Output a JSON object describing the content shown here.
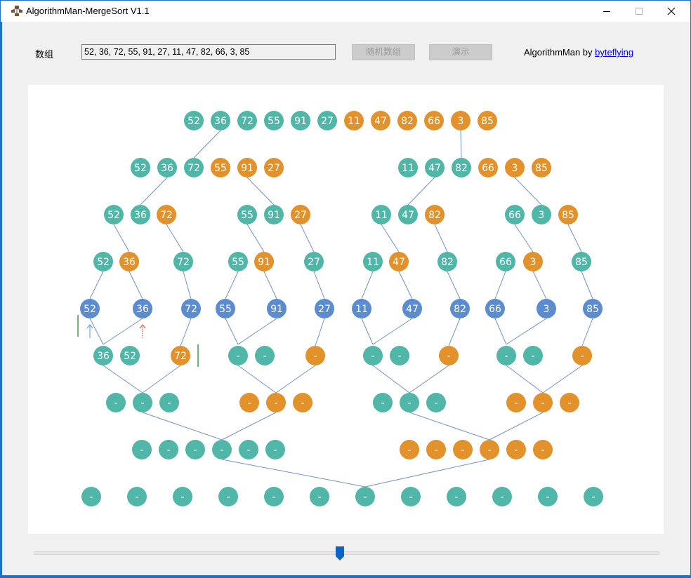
{
  "window": {
    "title": "AlgorithmMan-MergeSort V1.1"
  },
  "toolbar": {
    "array_label": "数组",
    "array_value": "52, 36, 72, 55, 91, 27, 11, 47, 82, 66, 3, 85",
    "random_button": "随机数组",
    "demo_button": "演示",
    "credit_prefix": "AlgorithmMan by ",
    "credit_link": "byteflying"
  },
  "slider": {
    "position_percent": 49
  },
  "colors": {
    "teal": "#4fb6a8",
    "orange": "#e3912a",
    "blue": "#5b8ccf",
    "line": "#6f93c7",
    "left_pointer": "#6fa6e0",
    "right_pointer": "#d0614d",
    "marker_green": "#3a9a4a"
  },
  "tree": {
    "rows": [
      [
        {
          "v": "52",
          "c": "teal"
        },
        {
          "v": "36",
          "c": "teal"
        },
        {
          "v": "72",
          "c": "teal"
        },
        {
          "v": "55",
          "c": "teal"
        },
        {
          "v": "91",
          "c": "teal"
        },
        {
          "v": "27",
          "c": "teal"
        },
        {
          "v": "11",
          "c": "orange"
        },
        {
          "v": "47",
          "c": "orange"
        },
        {
          "v": "82",
          "c": "orange"
        },
        {
          "v": "66",
          "c": "orange"
        },
        {
          "v": "3",
          "c": "orange"
        },
        {
          "v": "85",
          "c": "orange"
        }
      ],
      [
        {
          "v": "52",
          "c": "teal"
        },
        {
          "v": "36",
          "c": "teal"
        },
        {
          "v": "72",
          "c": "teal"
        },
        {
          "v": "55",
          "c": "orange"
        },
        {
          "v": "91",
          "c": "orange"
        },
        {
          "v": "27",
          "c": "orange"
        },
        {
          "v": "11",
          "c": "teal"
        },
        {
          "v": "47",
          "c": "teal"
        },
        {
          "v": "82",
          "c": "teal"
        },
        {
          "v": "66",
          "c": "orange"
        },
        {
          "v": "3",
          "c": "orange"
        },
        {
          "v": "85",
          "c": "orange"
        }
      ],
      [
        {
          "v": "52",
          "c": "teal"
        },
        {
          "v": "36",
          "c": "teal"
        },
        {
          "v": "72",
          "c": "orange"
        },
        {
          "v": "55",
          "c": "teal"
        },
        {
          "v": "91",
          "c": "teal"
        },
        {
          "v": "27",
          "c": "orange"
        },
        {
          "v": "11",
          "c": "teal"
        },
        {
          "v": "47",
          "c": "teal"
        },
        {
          "v": "82",
          "c": "orange"
        },
        {
          "v": "66",
          "c": "teal"
        },
        {
          "v": "3",
          "c": "teal"
        },
        {
          "v": "85",
          "c": "orange"
        }
      ],
      [
        {
          "v": "52",
          "c": "teal"
        },
        {
          "v": "36",
          "c": "orange"
        },
        {
          "v": "72",
          "c": "teal"
        },
        {
          "v": "55",
          "c": "teal"
        },
        {
          "v": "91",
          "c": "orange"
        },
        {
          "v": "27",
          "c": "teal"
        },
        {
          "v": "11",
          "c": "teal"
        },
        {
          "v": "47",
          "c": "orange"
        },
        {
          "v": "82",
          "c": "teal"
        },
        {
          "v": "66",
          "c": "teal"
        },
        {
          "v": "3",
          "c": "orange"
        },
        {
          "v": "85",
          "c": "teal"
        }
      ],
      [
        {
          "v": "52",
          "c": "blue"
        },
        {
          "v": "36",
          "c": "blue"
        },
        {
          "v": "72",
          "c": "blue"
        },
        {
          "v": "55",
          "c": "blue"
        },
        {
          "v": "91",
          "c": "blue"
        },
        {
          "v": "27",
          "c": "blue"
        },
        {
          "v": "11",
          "c": "blue"
        },
        {
          "v": "47",
          "c": "blue"
        },
        {
          "v": "82",
          "c": "blue"
        },
        {
          "v": "66",
          "c": "blue"
        },
        {
          "v": "3",
          "c": "blue"
        },
        {
          "v": "85",
          "c": "blue"
        }
      ],
      [
        {
          "v": "36",
          "c": "teal"
        },
        {
          "v": "52",
          "c": "teal"
        },
        {
          "v": "72",
          "c": "orange"
        },
        {
          "v": "-",
          "c": "teal"
        },
        {
          "v": "-",
          "c": "teal"
        },
        {
          "v": "-",
          "c": "orange"
        },
        {
          "v": "-",
          "c": "teal"
        },
        {
          "v": "-",
          "c": "teal"
        },
        {
          "v": "-",
          "c": "orange"
        },
        {
          "v": "-",
          "c": "teal"
        },
        {
          "v": "-",
          "c": "teal"
        },
        {
          "v": "-",
          "c": "orange"
        }
      ],
      [
        {
          "v": "-",
          "c": "teal"
        },
        {
          "v": "-",
          "c": "teal"
        },
        {
          "v": "-",
          "c": "teal"
        },
        {
          "v": "-",
          "c": "orange"
        },
        {
          "v": "-",
          "c": "orange"
        },
        {
          "v": "-",
          "c": "orange"
        },
        {
          "v": "-",
          "c": "teal"
        },
        {
          "v": "-",
          "c": "teal"
        },
        {
          "v": "-",
          "c": "teal"
        },
        {
          "v": "-",
          "c": "orange"
        },
        {
          "v": "-",
          "c": "orange"
        },
        {
          "v": "-",
          "c": "orange"
        }
      ],
      [
        {
          "v": "-",
          "c": "teal"
        },
        {
          "v": "-",
          "c": "teal"
        },
        {
          "v": "-",
          "c": "teal"
        },
        {
          "v": "-",
          "c": "teal"
        },
        {
          "v": "-",
          "c": "teal"
        },
        {
          "v": "-",
          "c": "teal"
        },
        {
          "v": "-",
          "c": "orange"
        },
        {
          "v": "-",
          "c": "orange"
        },
        {
          "v": "-",
          "c": "orange"
        },
        {
          "v": "-",
          "c": "orange"
        },
        {
          "v": "-",
          "c": "orange"
        },
        {
          "v": "-",
          "c": "orange"
        }
      ],
      [
        {
          "v": "-",
          "c": "teal"
        },
        {
          "v": "-",
          "c": "teal"
        },
        {
          "v": "-",
          "c": "teal"
        },
        {
          "v": "-",
          "c": "teal"
        },
        {
          "v": "-",
          "c": "teal"
        },
        {
          "v": "-",
          "c": "teal"
        },
        {
          "v": "-",
          "c": "teal"
        },
        {
          "v": "-",
          "c": "teal"
        },
        {
          "v": "-",
          "c": "teal"
        },
        {
          "v": "-",
          "c": "teal"
        },
        {
          "v": "-",
          "c": "teal"
        },
        {
          "v": "-",
          "c": "teal"
        }
      ]
    ]
  }
}
